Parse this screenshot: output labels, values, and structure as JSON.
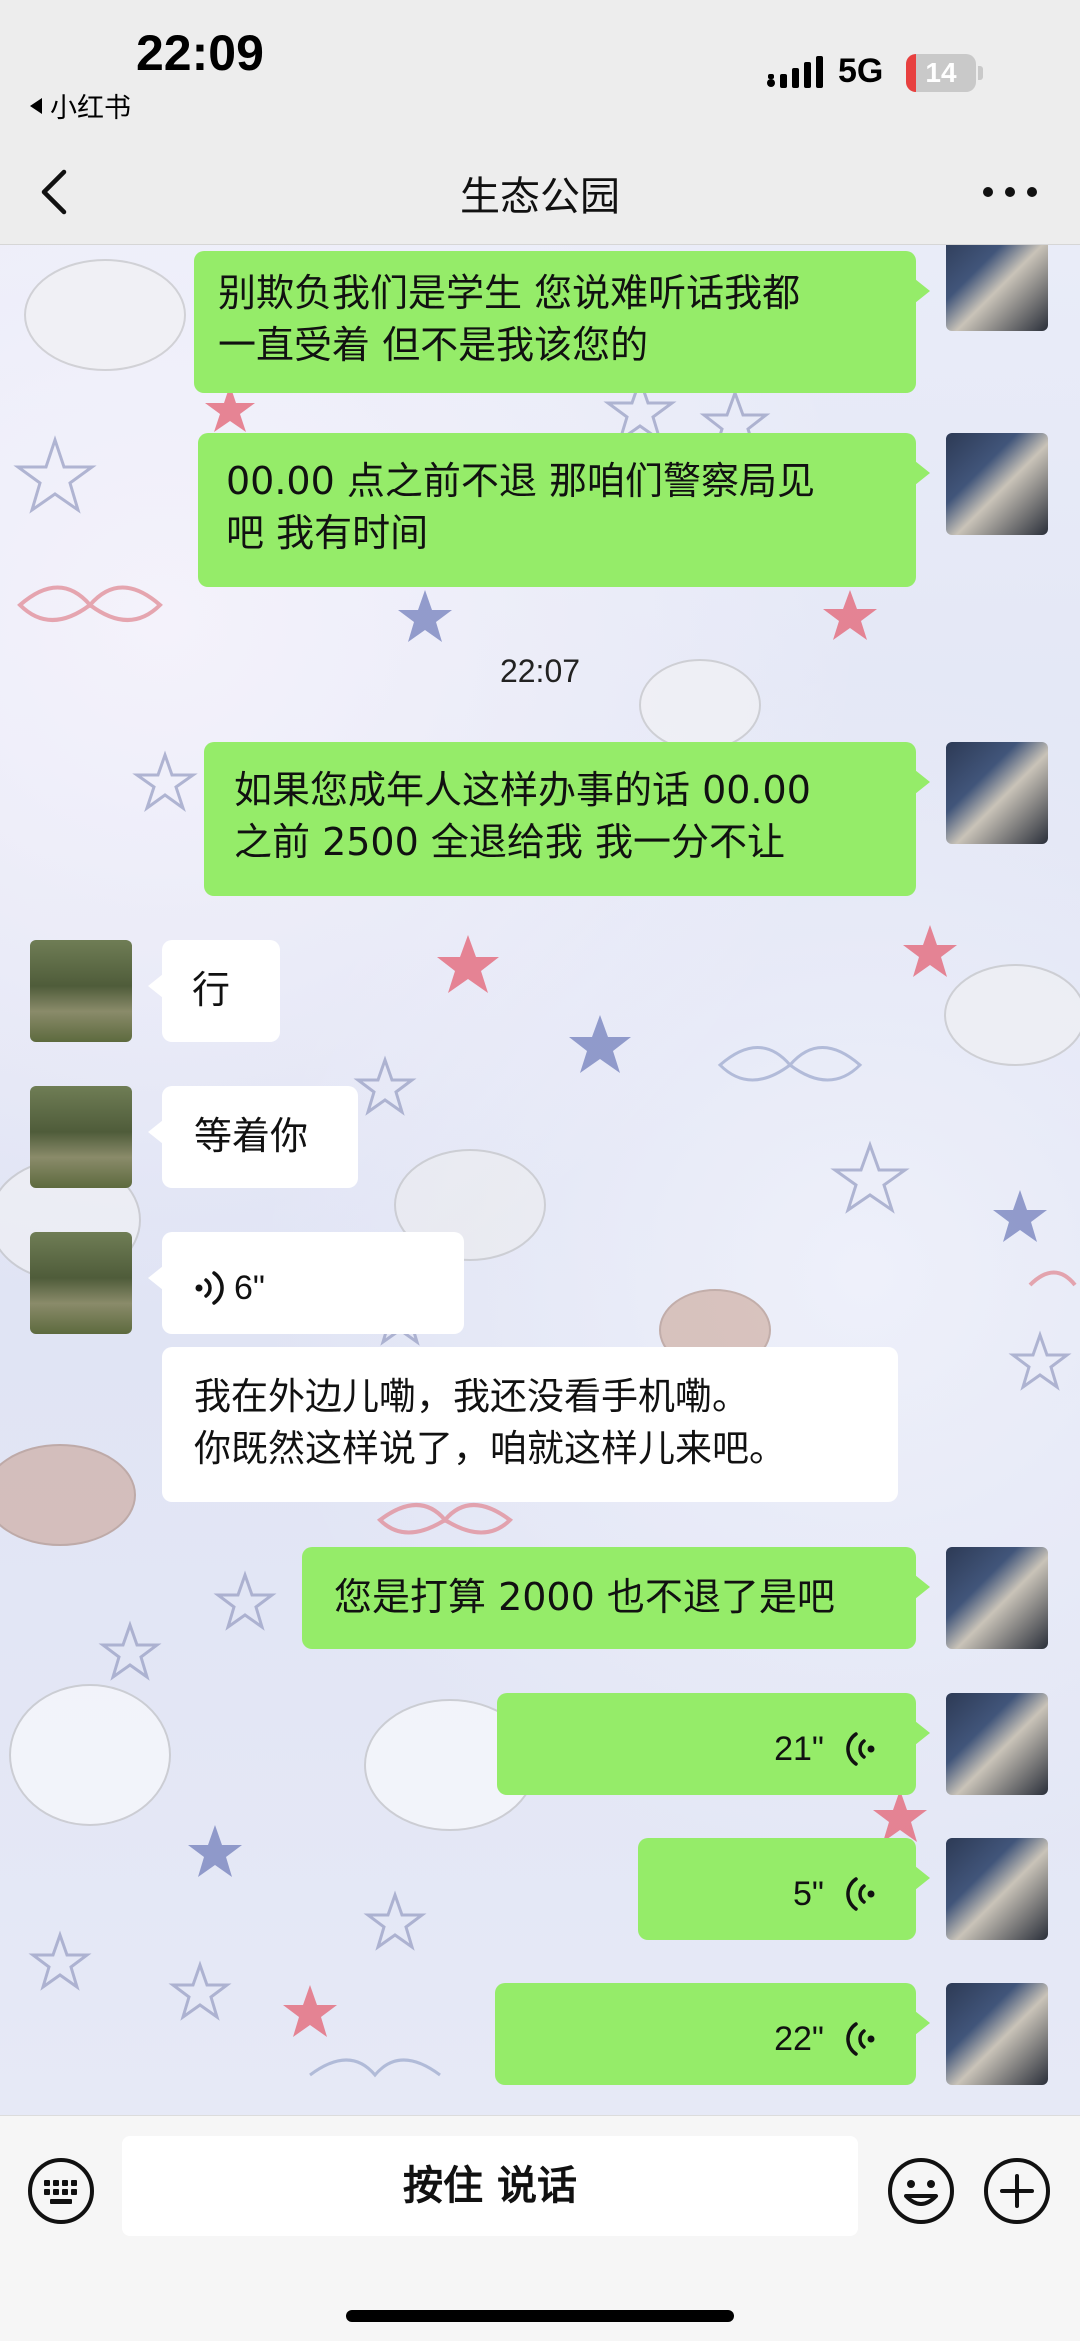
{
  "status_bar": {
    "time": "22:09",
    "back_app": "小红书",
    "network": "5G",
    "battery": "14",
    "battery_level": 0.14,
    "battery_color": "#e8403f"
  },
  "nav": {
    "title": "生态公园"
  },
  "colors": {
    "sent_bubble": "#95ec69",
    "received_bubble": "#ffffff"
  },
  "messages": [
    {
      "sender": "me",
      "type": "text",
      "text_lines": [
        "别欺负我们是学生 您说难听话我都",
        "一直受着 但不是我该您的"
      ]
    },
    {
      "sender": "me",
      "type": "text",
      "text_lines": [
        "00.00 点之前不退 那咱们警察局见",
        "吧 我有时间"
      ]
    },
    {
      "type": "timestamp",
      "text": "22:07"
    },
    {
      "sender": "me",
      "type": "text",
      "text_lines": [
        "如果您成年人这样办事的话 00.00",
        "之前 2500 全退给我  我一分不让"
      ]
    },
    {
      "sender": "other",
      "type": "text",
      "text_lines": [
        "行"
      ]
    },
    {
      "sender": "other",
      "type": "text",
      "text_lines": [
        "等着你"
      ]
    },
    {
      "sender": "other",
      "type": "voice",
      "duration": "6\""
    },
    {
      "sender": "other",
      "type": "transcript",
      "text_lines": [
        "我在外边儿嘞，我还没看手机嘞。",
        "你既然这样说了，咱就这样儿来吧。"
      ]
    },
    {
      "sender": "me",
      "type": "text",
      "text_lines": [
        "您是打算 2000 也不退了是吧"
      ]
    },
    {
      "sender": "me",
      "type": "voice",
      "duration": "21\""
    },
    {
      "sender": "me",
      "type": "voice",
      "duration": "5\""
    },
    {
      "sender": "me",
      "type": "voice",
      "duration": "22\""
    }
  ],
  "input_bar": {
    "talk_label": "按住 说话",
    "keyboard_icon": "keyboard-icon",
    "emoji_icon": "emoji-icon",
    "plus_icon": "plus-icon"
  }
}
